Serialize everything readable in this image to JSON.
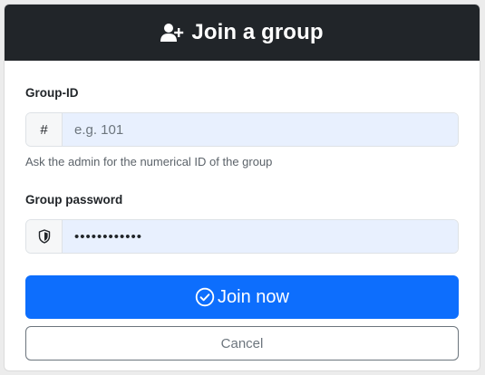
{
  "header": {
    "title": "Join a group",
    "icon": "user-plus-icon"
  },
  "group_id": {
    "label": "Group-ID",
    "addon": "#",
    "placeholder": "e.g. 101",
    "value": "",
    "help": "Ask the admin for the numerical ID of the group"
  },
  "password": {
    "label": "Group password",
    "addon_icon": "shield-icon",
    "value": "••••••••••••"
  },
  "buttons": {
    "join_label": "Join now",
    "join_icon": "check-circle-icon",
    "cancel_label": "Cancel"
  },
  "colors": {
    "header_bg": "#212529",
    "primary": "#0d6efd",
    "input_autofill_bg": "#e8f0fe",
    "secondary": "#6c757d"
  }
}
